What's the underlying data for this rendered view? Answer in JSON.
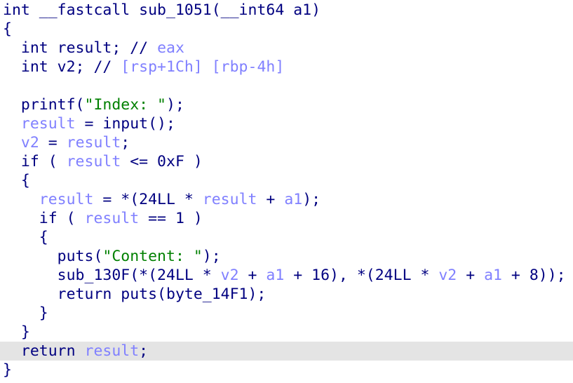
{
  "editor": {
    "lines": [
      {
        "highlighted": false,
        "tokens": [
          {
            "t": "int __fastcall sub_1051(__int64 a1)",
            "k": "plain"
          }
        ]
      },
      {
        "highlighted": false,
        "tokens": [
          {
            "t": "{",
            "k": "plain"
          }
        ]
      },
      {
        "highlighted": false,
        "tokens": [
          {
            "t": "  int result; // ",
            "k": "plain"
          },
          {
            "t": "eax",
            "k": "var"
          }
        ]
      },
      {
        "highlighted": false,
        "tokens": [
          {
            "t": "  int v2; // ",
            "k": "plain"
          },
          {
            "t": "[rsp+1Ch] [rbp-4h]",
            "k": "var"
          }
        ]
      },
      {
        "highlighted": false,
        "tokens": []
      },
      {
        "highlighted": false,
        "tokens": [
          {
            "t": "  printf(",
            "k": "plain"
          },
          {
            "t": "\"Index: \"",
            "k": "str"
          },
          {
            "t": ");",
            "k": "plain"
          }
        ]
      },
      {
        "highlighted": false,
        "tokens": [
          {
            "t": "  ",
            "k": "plain"
          },
          {
            "t": "result",
            "k": "var"
          },
          {
            "t": " = input();",
            "k": "plain"
          }
        ]
      },
      {
        "highlighted": false,
        "tokens": [
          {
            "t": "  ",
            "k": "plain"
          },
          {
            "t": "v2",
            "k": "var"
          },
          {
            "t": " = ",
            "k": "plain"
          },
          {
            "t": "result",
            "k": "var"
          },
          {
            "t": ";",
            "k": "plain"
          }
        ]
      },
      {
        "highlighted": false,
        "tokens": [
          {
            "t": "  if ( ",
            "k": "plain"
          },
          {
            "t": "result",
            "k": "var"
          },
          {
            "t": " <= 0xF )",
            "k": "plain"
          }
        ]
      },
      {
        "highlighted": false,
        "tokens": [
          {
            "t": "  {",
            "k": "plain"
          }
        ]
      },
      {
        "highlighted": false,
        "tokens": [
          {
            "t": "    ",
            "k": "plain"
          },
          {
            "t": "result",
            "k": "var"
          },
          {
            "t": " = *(24LL * ",
            "k": "plain"
          },
          {
            "t": "result",
            "k": "var"
          },
          {
            "t": " + ",
            "k": "plain"
          },
          {
            "t": "a1",
            "k": "var"
          },
          {
            "t": ");",
            "k": "plain"
          }
        ]
      },
      {
        "highlighted": false,
        "tokens": [
          {
            "t": "    if ( ",
            "k": "plain"
          },
          {
            "t": "result",
            "k": "var"
          },
          {
            "t": " == 1 )",
            "k": "plain"
          }
        ]
      },
      {
        "highlighted": false,
        "tokens": [
          {
            "t": "    {",
            "k": "plain"
          }
        ]
      },
      {
        "highlighted": false,
        "tokens": [
          {
            "t": "      puts(",
            "k": "plain"
          },
          {
            "t": "\"Content: \"",
            "k": "str"
          },
          {
            "t": ");",
            "k": "plain"
          }
        ]
      },
      {
        "highlighted": false,
        "tokens": [
          {
            "t": "      sub_130F(*(24LL * ",
            "k": "plain"
          },
          {
            "t": "v2",
            "k": "var"
          },
          {
            "t": " + ",
            "k": "plain"
          },
          {
            "t": "a1",
            "k": "var"
          },
          {
            "t": " + 16), *(24LL * ",
            "k": "plain"
          },
          {
            "t": "v2",
            "k": "var"
          },
          {
            "t": " + ",
            "k": "plain"
          },
          {
            "t": "a1",
            "k": "var"
          },
          {
            "t": " + 8));",
            "k": "plain"
          }
        ]
      },
      {
        "highlighted": false,
        "tokens": [
          {
            "t": "      return puts(byte_14F1);",
            "k": "plain"
          }
        ]
      },
      {
        "highlighted": false,
        "tokens": [
          {
            "t": "    }",
            "k": "plain"
          }
        ]
      },
      {
        "highlighted": false,
        "tokens": [
          {
            "t": "  }",
            "k": "plain"
          }
        ]
      },
      {
        "highlighted": true,
        "tokens": [
          {
            "t": "  return ",
            "k": "plain"
          },
          {
            "t": "result",
            "k": "var"
          },
          {
            "t": ";",
            "k": "plain"
          }
        ]
      },
      {
        "highlighted": false,
        "tokens": [
          {
            "t": "}",
            "k": "plain"
          }
        ]
      }
    ]
  }
}
